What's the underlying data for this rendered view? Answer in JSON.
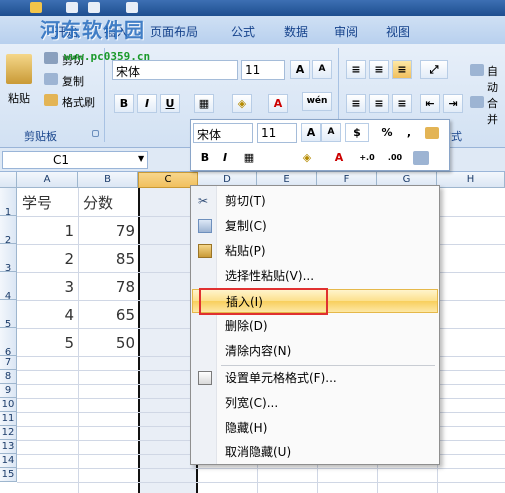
{
  "watermark": {
    "site": "河东软件园",
    "url": "www.pc0359.cn"
  },
  "ribbon_tabs": [
    "开始",
    "插入",
    "页面布局",
    "公式",
    "数据",
    "审阅",
    "视图"
  ],
  "clipboard": {
    "group_label": "剪贴板",
    "paste_label": "粘贴",
    "cut_label": "剪切",
    "copy_label": "复制",
    "format_painter_label": "格式刷"
  },
  "font": {
    "name": "宋体",
    "size": "11",
    "bold": "B",
    "italic": "I",
    "underline": "U",
    "font_color_letter": "A",
    "phonetic": "wén"
  },
  "alignment": {
    "wrap_label": "自动",
    "merge_label": "合并"
  },
  "partial_group_label": "方式",
  "formula_bar": {
    "name_box": "C1"
  },
  "mini_toolbar": {
    "font_name": "宋体",
    "font_size": "11",
    "percent": "%",
    "comma": ",",
    "bold": "B",
    "italic": "I",
    "increase_dec": "+.0",
    "decrease_dec": ".00"
  },
  "grid": {
    "columns": [
      "A",
      "B",
      "C",
      "D",
      "E",
      "F",
      "G",
      "H"
    ],
    "rows": [
      "1",
      "2",
      "3",
      "4",
      "5",
      "6",
      "7",
      "8",
      "9",
      "10",
      "11",
      "12",
      "13",
      "14",
      "15"
    ],
    "header_row": [
      "学号",
      "分数"
    ],
    "data": [
      [
        "1",
        "79"
      ],
      [
        "2",
        "85"
      ],
      [
        "3",
        "78"
      ],
      [
        "4",
        "65"
      ],
      [
        "5",
        "50"
      ]
    ]
  },
  "context_menu": {
    "items": [
      {
        "label": "剪切(T)",
        "icon": "scissors-icon"
      },
      {
        "label": "复制(C)",
        "icon": "copy-icon"
      },
      {
        "label": "粘贴(P)",
        "icon": "paste-icon"
      },
      {
        "label": "选择性粘贴(V)...",
        "icon": ""
      },
      {
        "label": "插入(I)",
        "icon": "",
        "highlighted": true
      },
      {
        "label": "删除(D)",
        "icon": ""
      },
      {
        "label": "清除内容(N)",
        "icon": ""
      },
      {
        "label": "设置单元格格式(F)...",
        "icon": "format-cells-icon"
      },
      {
        "label": "列宽(C)...",
        "icon": ""
      },
      {
        "label": "隐藏(H)",
        "icon": ""
      },
      {
        "label": "取消隐藏(U)",
        "icon": ""
      }
    ]
  },
  "colors": {
    "accent": "#f1c05e",
    "highlight_box": "#e03030",
    "ribbon": "#d2e1f3"
  }
}
